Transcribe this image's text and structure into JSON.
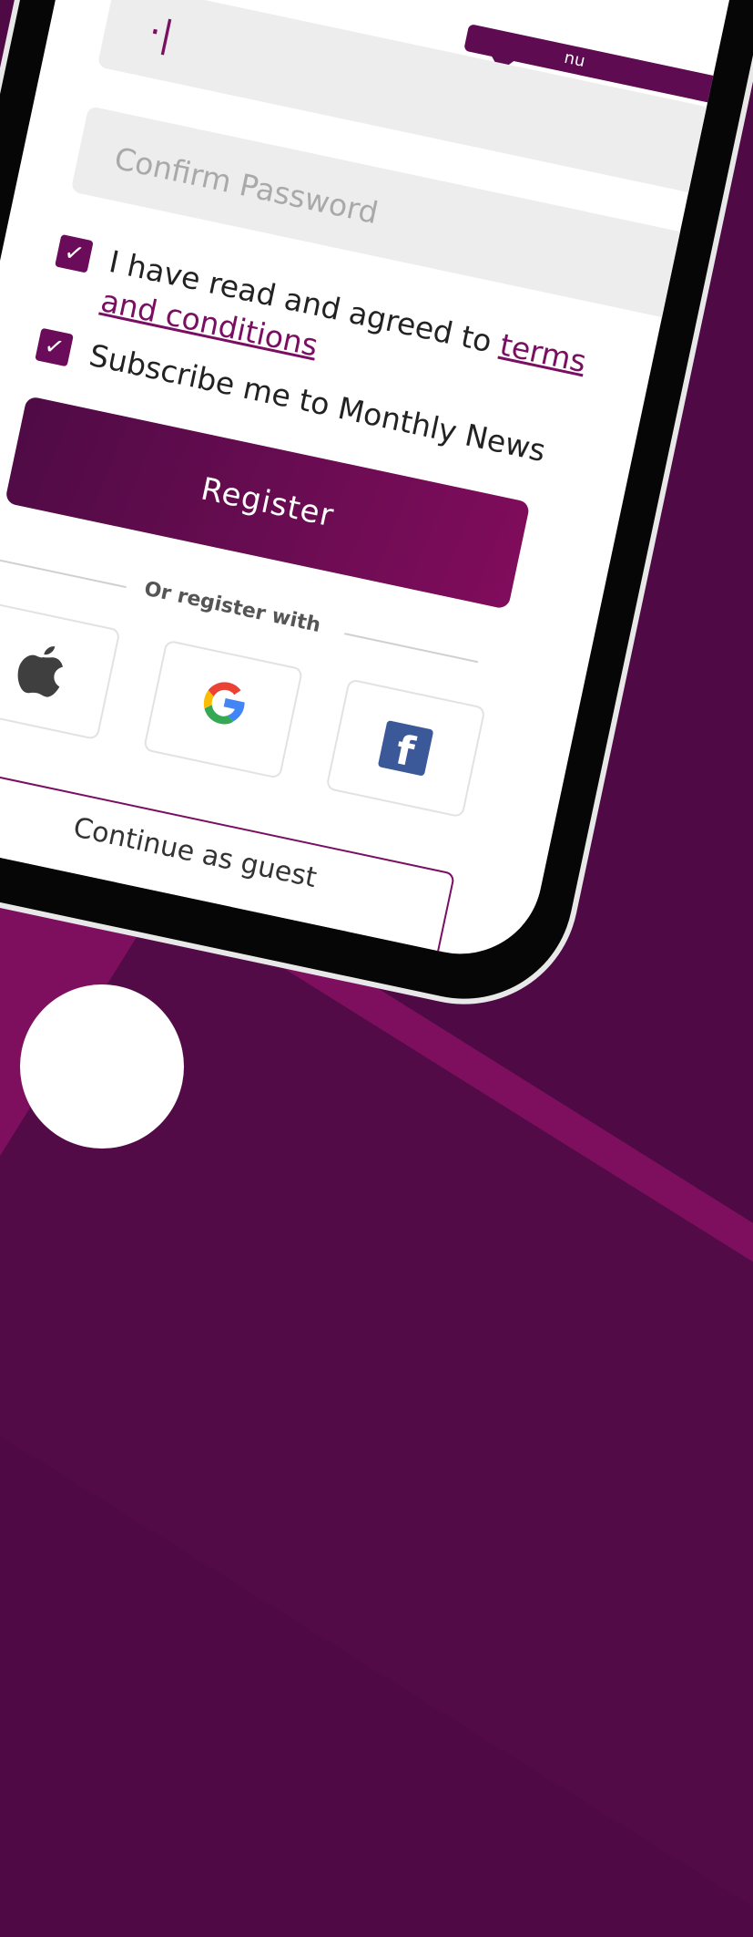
{
  "password": {
    "tooltip_text": "nu",
    "value": "·|"
  },
  "confirm_password": {
    "placeholder": "Confirm Password"
  },
  "terms": {
    "checked": true,
    "text": "I have read and agreed to ",
    "link_text": "terms and conditions"
  },
  "newsletter": {
    "checked": true,
    "text": "Subscribe me to Monthly News"
  },
  "register_button": {
    "label": "Register"
  },
  "divider": {
    "text": "Or register with"
  },
  "social": [
    {
      "name": "apple",
      "icon": "apple-icon"
    },
    {
      "name": "google",
      "icon": "google-icon",
      "glyph": "G"
    },
    {
      "name": "facebook",
      "icon": "facebook-icon",
      "glyph": "f"
    }
  ],
  "guest_button": {
    "label": "Continue as guest"
  },
  "colors": {
    "brand": "#6b0c5a",
    "brand_dark": "#4f0a45",
    "background": "#4f0a45",
    "facebook": "#3b5998"
  }
}
